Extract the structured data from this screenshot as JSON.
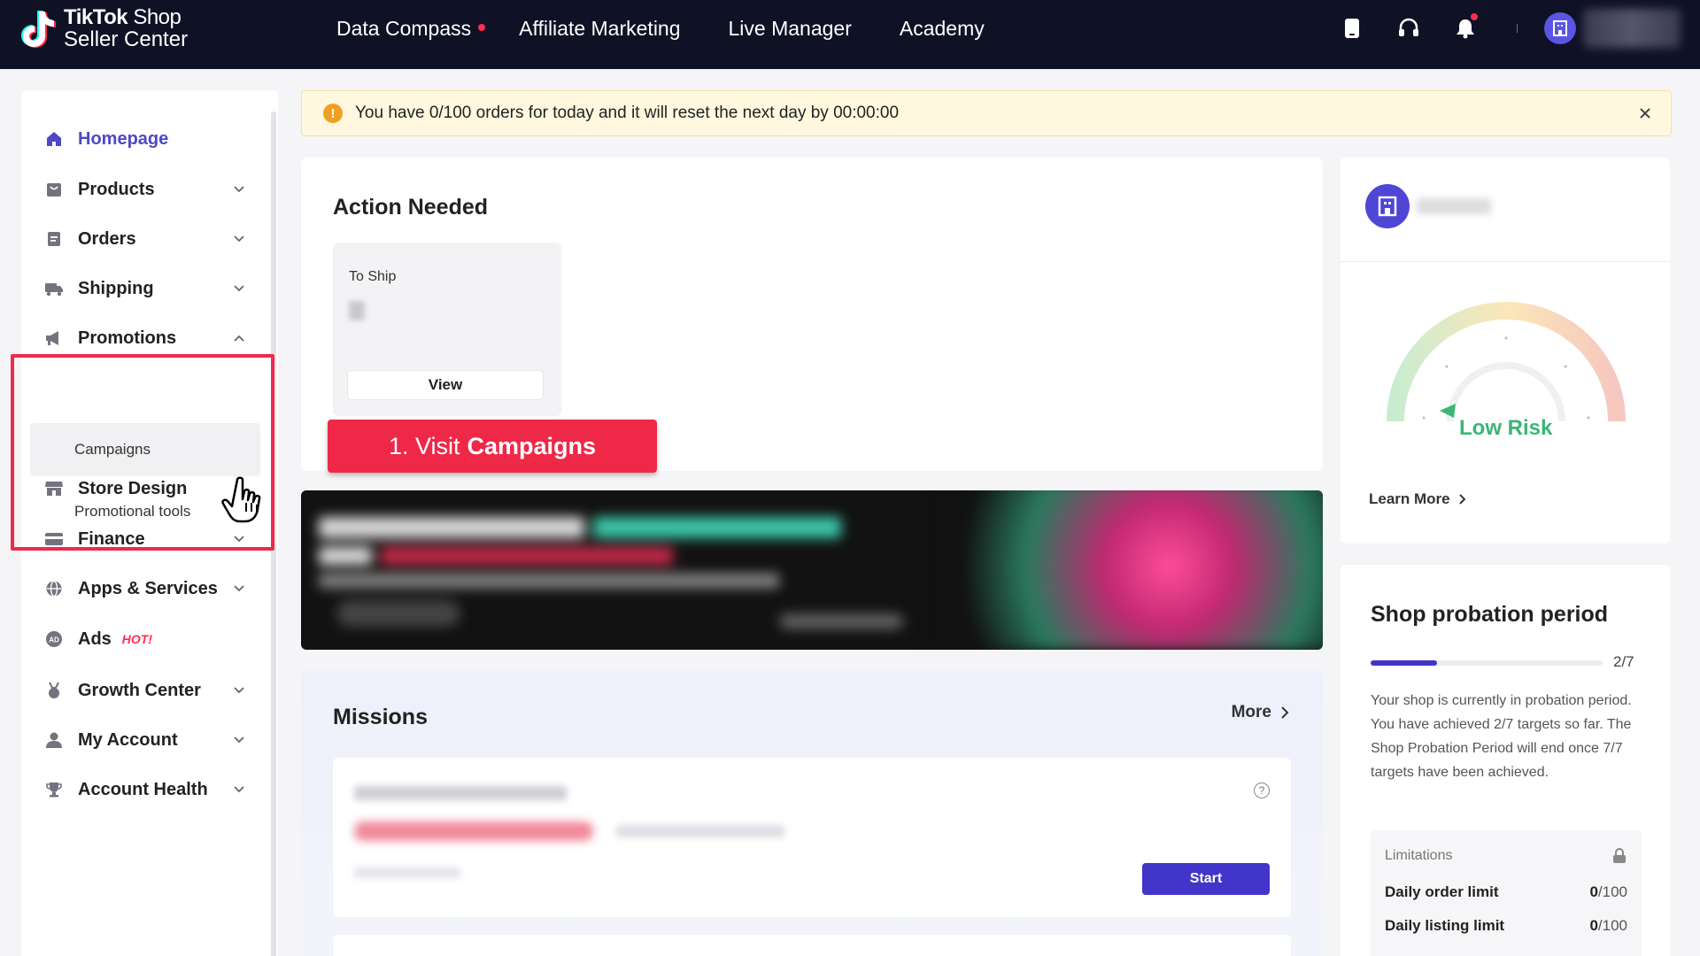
{
  "header": {
    "logo_line1_brand": "TikTok",
    "logo_line1_suffix": "Shop",
    "logo_line2": "Seller Center",
    "nav": [
      {
        "label": "Data Compass",
        "has_dot": true
      },
      {
        "label": "Affiliate Marketing"
      },
      {
        "label": "Live Manager"
      },
      {
        "label": "Academy"
      }
    ],
    "icons": [
      "phone-icon",
      "headset-icon",
      "bell-icon",
      "store-avatar-icon"
    ]
  },
  "sidebar": {
    "items": [
      {
        "label": "Homepage",
        "icon": "home-icon",
        "active": true
      },
      {
        "label": "Products",
        "icon": "bag-icon"
      },
      {
        "label": "Orders",
        "icon": "clipboard-icon"
      },
      {
        "label": "Shipping",
        "icon": "truck-icon"
      },
      {
        "label": "Promotions",
        "icon": "megaphone-icon",
        "expanded": true
      },
      {
        "label": "Store Design",
        "icon": "store-icon"
      },
      {
        "label": "Finance",
        "icon": "card-icon"
      },
      {
        "label": "Apps & Services",
        "icon": "globe-icon"
      },
      {
        "label": "Ads",
        "icon": "ads-icon",
        "badge": "HOT!"
      },
      {
        "label": "Growth Center",
        "icon": "medal-icon"
      },
      {
        "label": "My Account",
        "icon": "user-icon"
      },
      {
        "label": "Account Health",
        "icon": "trophy-icon"
      }
    ],
    "promotions_sub": [
      "Campaigns",
      "Promotional tools"
    ]
  },
  "alert": {
    "text": "You have 0/100 orders for today and it will reset the next day by 00:00:00",
    "icon": "!"
  },
  "action_needed": {
    "title": "Action Needed",
    "to_ship_label": "To Ship",
    "view_label": "View"
  },
  "callout": {
    "prefix": "1. Visit",
    "bold": "Campaigns"
  },
  "missions": {
    "title": "Missions",
    "more_label": "More",
    "start_label": "Start",
    "help_icon": "?"
  },
  "shop_health": {
    "risk_label": "Low Risk",
    "learn_more": "Learn More"
  },
  "probation": {
    "title": "Shop probation period",
    "progress_achieved": 2,
    "progress_total": 7,
    "progress_text": "2/7",
    "description": "Your shop is currently in probation period. You have achieved 2/7 targets so far. The Shop Probation Period will end once 7/7 targets have been achieved.",
    "limitations_title": "Limitations",
    "limits": [
      {
        "label": "Daily order limit",
        "used": "0",
        "max": "/100"
      },
      {
        "label": "Daily listing limit",
        "used": "0",
        "max": "/100"
      }
    ]
  },
  "colors": {
    "topbar": "#0f1125",
    "accent": "#4136c9",
    "active_nav": "#4c48c8",
    "callout": "#ef2848",
    "low_risk": "#3bb676"
  }
}
